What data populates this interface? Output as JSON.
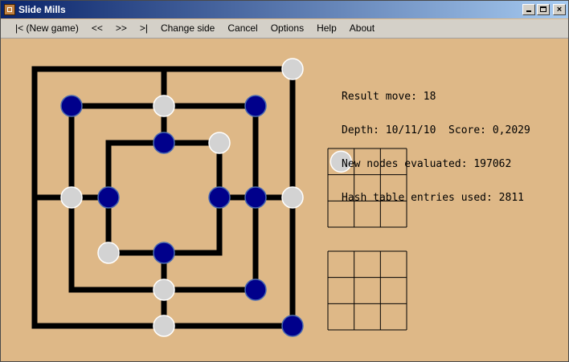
{
  "window": {
    "title": "Slide Mills",
    "minimize_label": "",
    "maximize_label": "",
    "close_label": "×"
  },
  "menu": [
    {
      "label": "|<  (New game)"
    },
    {
      "label": "<<"
    },
    {
      "label": ">>"
    },
    {
      "label": ">|"
    },
    {
      "label": "Change side"
    },
    {
      "label": "Cancel"
    },
    {
      "label": "Options"
    },
    {
      "label": "Help"
    },
    {
      "label": "About"
    }
  ],
  "info": {
    "result_move": "Result move: 18",
    "depth_score": "Depth: 10/11/10  Score: 0,2029",
    "nodes": "New nodes evaluated: 197062",
    "hash": "Hash table entries used: 2811"
  },
  "colors": {
    "background": "#deb887",
    "blue_piece": "#00008b",
    "white_piece": "#d3d3d3",
    "line": "#000000"
  },
  "board": {
    "grid": 7,
    "pieces": [
      {
        "col": 6,
        "row": 0,
        "color": "white"
      },
      {
        "col": 1,
        "row": 1,
        "color": "blue"
      },
      {
        "col": 3,
        "row": 1,
        "color": "white"
      },
      {
        "col": 5,
        "row": 1,
        "color": "blue"
      },
      {
        "col": 3,
        "row": 2,
        "color": "blue"
      },
      {
        "col": 4,
        "row": 2,
        "color": "white"
      },
      {
        "col": 1,
        "row": 3,
        "color": "white"
      },
      {
        "col": 2,
        "row": 3,
        "color": "blue"
      },
      {
        "col": 4,
        "row": 3,
        "color": "blue"
      },
      {
        "col": 5,
        "row": 3,
        "color": "blue"
      },
      {
        "col": 6,
        "row": 3,
        "color": "white"
      },
      {
        "col": 2,
        "row": 4,
        "color": "white"
      },
      {
        "col": 3,
        "row": 4,
        "color": "blue"
      },
      {
        "col": 3,
        "row": 5,
        "color": "white"
      },
      {
        "col": 5,
        "row": 5,
        "color": "blue"
      },
      {
        "col": 3,
        "row": 6,
        "color": "white"
      },
      {
        "col": 6,
        "row": 6,
        "color": "blue"
      }
    ]
  },
  "captured_grids": [
    {
      "pieces": [
        {
          "col": 0,
          "row": 0,
          "color": "white"
        }
      ]
    },
    {
      "pieces": []
    }
  ]
}
